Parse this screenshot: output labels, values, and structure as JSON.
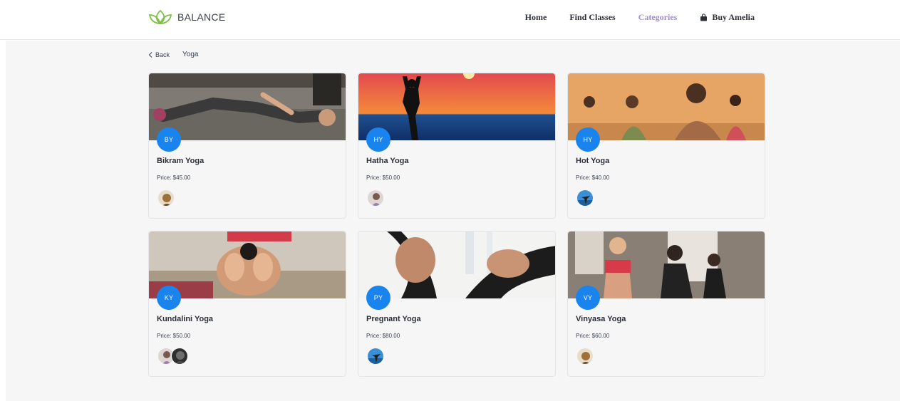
{
  "brand": {
    "name": "BALANCE"
  },
  "nav": {
    "home": "Home",
    "find_classes": "Find Classes",
    "categories": "Categories",
    "buy": "Buy Amelia"
  },
  "breadcrumb": {
    "back": "Back",
    "title": "Yoga"
  },
  "colors": {
    "accent": "#9f8bdc",
    "badge": "#1a84ee",
    "background": "#f6f6f6"
  },
  "cards": [
    {
      "initials": "BY",
      "name": "Bikram Yoga",
      "price": "Price: $45.00"
    },
    {
      "initials": "HY",
      "name": "Hatha Yoga",
      "price": "Price: $50.00"
    },
    {
      "initials": "HY",
      "name": "Hot Yoga",
      "price": "Price: $40.00"
    },
    {
      "initials": "KY",
      "name": "Kundalini Yoga",
      "price": "Price: $50.00"
    },
    {
      "initials": "PY",
      "name": "Pregnant Yoga",
      "price": "Price: $80.00"
    },
    {
      "initials": "VY",
      "name": "Vinyasa Yoga",
      "price": "Price: $60.00"
    }
  ]
}
